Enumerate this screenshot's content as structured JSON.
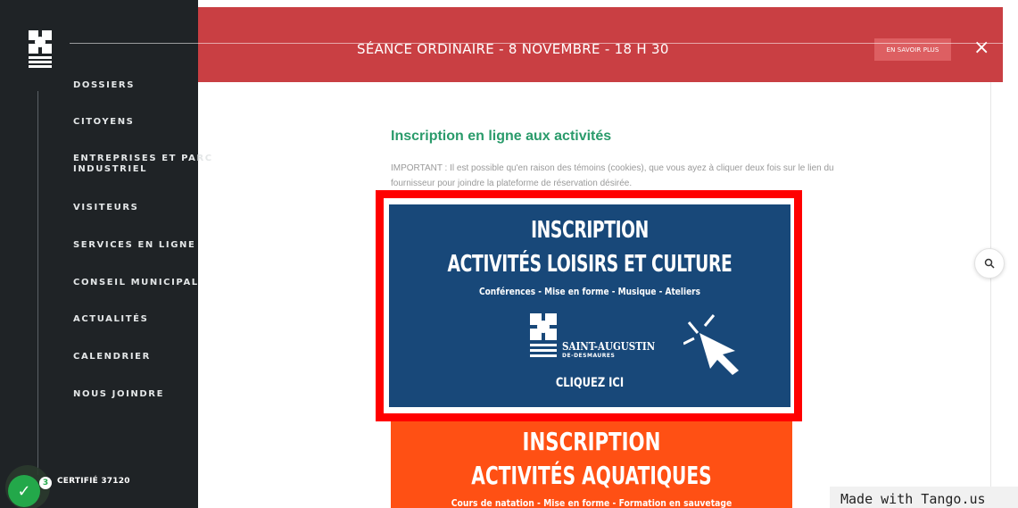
{
  "sidebar": {
    "items": [
      {
        "label": "DOSSIERS"
      },
      {
        "label": "CITOYENS"
      },
      {
        "label": "ENTREPRISES ET PARC"
      },
      {
        "label": "INDUSTRIEL"
      },
      {
        "label": "VISITEURS"
      },
      {
        "label": "SERVICES EN LIGNE"
      },
      {
        "label": "CONSEIL MUNICIPAL"
      },
      {
        "label": "ACTUALITÉS"
      },
      {
        "label": "CALENDRIER"
      },
      {
        "label": "NOUS JOINDRE"
      }
    ],
    "certification": "CERTIFIÉ 37120",
    "badge_count": "3"
  },
  "banner": {
    "title": "SÉANCE ORDINAIRE - 8 NOVEMBRE - 18 H 30",
    "learn_more": "EN SAVOIR PLUS",
    "close": "×"
  },
  "main": {
    "heading": "Inscription en ligne aux activités",
    "notice": "IMPORTANT : Il est possible qu'en raison des témoins (cookies), que vous ayez à cliquer deux fois sur le lien du fournisseur pour joindre la plateforme de réservation désirée."
  },
  "card_culture": {
    "title_line1": "INSCRIPTION",
    "title_line2": "ACTIVITÉS LOISIRS ET CULTURE",
    "subtitle": "Conférences - Mise en forme - Musique - Ateliers",
    "city_name": "SAINT-AUGUSTIN",
    "city_sub": "DE-DESMAURES",
    "cta": "CLIQUEZ ICI"
  },
  "card_aquatic": {
    "title_line1": "INSCRIPTION",
    "title_line2": "ACTIVITÉS AQUATIQUES",
    "subtitle": "Cours de natation - Mise en forme - Formation en sauvetage"
  },
  "watermark": "Made with Tango.us",
  "colors": {
    "sidebar_bg": "#1f2326",
    "banner_bg": "#c93f43",
    "heading_green": "#2a9b6b",
    "card_blue": "#184879",
    "card_orange": "#ff5014",
    "highlight_red": "#ff0000"
  },
  "icons": {
    "logo": "city-logo-icon",
    "search": "search-icon",
    "close": "close-icon",
    "cursor": "click-cursor-icon",
    "check": "check-icon"
  }
}
